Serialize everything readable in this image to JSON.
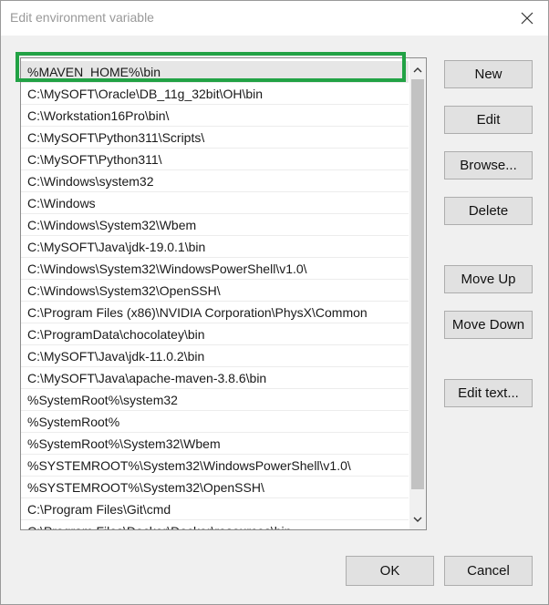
{
  "window": {
    "title": "Edit environment variable"
  },
  "list": {
    "items": [
      "%MAVEN_HOME%\\bin",
      "C:\\MySOFT\\Oracle\\DB_11g_32bit\\OH\\bin",
      "C:\\Workstation16Pro\\bin\\",
      "C:\\MySOFT\\Python311\\Scripts\\",
      "C:\\MySOFT\\Python311\\",
      "C:\\Windows\\system32",
      "C:\\Windows",
      "C:\\Windows\\System32\\Wbem",
      "C:\\MySOFT\\Java\\jdk-19.0.1\\bin",
      "C:\\Windows\\System32\\WindowsPowerShell\\v1.0\\",
      "C:\\Windows\\System32\\OpenSSH\\",
      "C:\\Program Files (x86)\\NVIDIA Corporation\\PhysX\\Common",
      "C:\\ProgramData\\chocolatey\\bin",
      "C:\\MySOFT\\Java\\jdk-11.0.2\\bin",
      "C:\\MySOFT\\Java\\apache-maven-3.8.6\\bin",
      "%SystemRoot%\\system32",
      "%SystemRoot%",
      "%SystemRoot%\\System32\\Wbem",
      "%SYSTEMROOT%\\System32\\WindowsPowerShell\\v1.0\\",
      "%SYSTEMROOT%\\System32\\OpenSSH\\",
      "C:\\Program Files\\Git\\cmd",
      "C:\\Program Files\\Docker\\Docker\\resources\\bin"
    ],
    "selected_index": 0
  },
  "buttons": {
    "new": "New",
    "edit": "Edit",
    "browse": "Browse...",
    "delete": "Delete",
    "move_up": "Move Up",
    "move_down": "Move Down",
    "edit_text": "Edit text...",
    "ok": "OK",
    "cancel": "Cancel"
  },
  "colors": {
    "highlight_box": "#22a245",
    "selected_row": "#e6e6e6"
  },
  "icons": {
    "close": "close-icon",
    "scroll_up": "chevron-up-icon",
    "scroll_down": "chevron-down-icon"
  }
}
